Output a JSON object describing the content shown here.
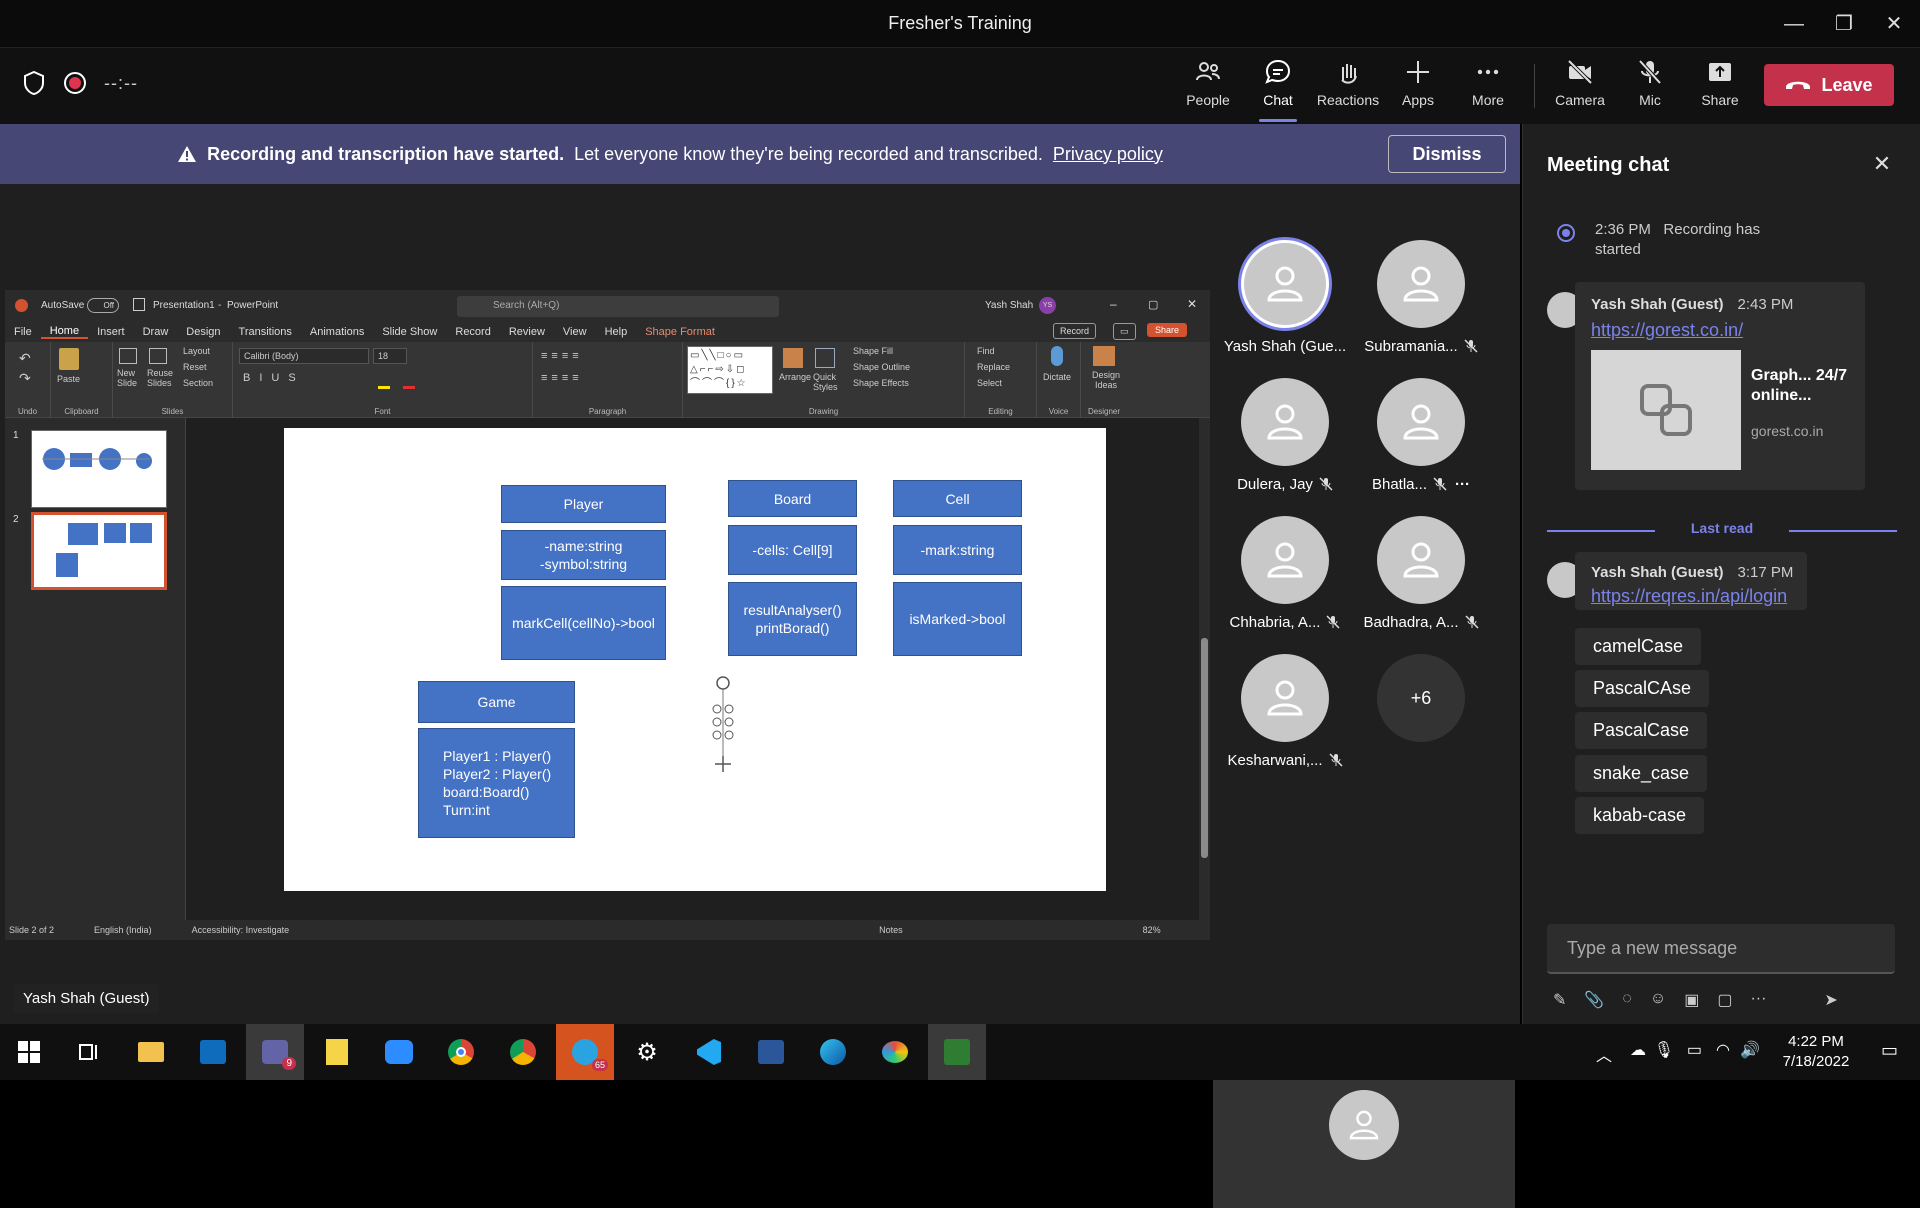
{
  "window": {
    "title": "Fresher's Training",
    "minimize": "—",
    "restore": "❐",
    "close": "✕"
  },
  "meeting_bar": {
    "timer": "--:--",
    "buttons": [
      {
        "label": "People"
      },
      {
        "label": "Chat"
      },
      {
        "label": "Reactions"
      },
      {
        "label": "Apps"
      },
      {
        "label": "More"
      },
      {
        "label": "Camera"
      },
      {
        "label": "Mic"
      },
      {
        "label": "Share"
      }
    ],
    "leave": "Leave",
    "accent": "#7b83eb",
    "leave_color": "#c4314b"
  },
  "banner": {
    "bold": "Recording and transcription have started.",
    "text": "Let everyone know they're being recorded and transcribed.",
    "link": "Privacy policy",
    "dismiss": "Dismiss"
  },
  "ppt": {
    "autosave": "AutoSave",
    "autosave_state": "Off",
    "file": "Presentation1",
    "app": "PowerPoint",
    "search": "Search (Alt+Q)",
    "user": "Yash Shah",
    "user_initials": "YS",
    "tabs": [
      "File",
      "Home",
      "Insert",
      "Draw",
      "Design",
      "Transitions",
      "Animations",
      "Slide Show",
      "Record",
      "Review",
      "View",
      "Help",
      "Shape Format"
    ],
    "record_btn": "Record",
    "share_btn": "Share",
    "groups": [
      "Undo",
      "Clipboard",
      "Slides",
      "Font",
      "Paragraph",
      "Drawing",
      "Editing",
      "Voice",
      "Designer"
    ],
    "ribbon": {
      "paste": "Paste",
      "new_slide": "New Slide",
      "reuse": "Reuse Slides",
      "layout": "Layout",
      "reset": "Reset",
      "section": "Section",
      "font": "Calibri (Body)",
      "size": "18",
      "arrange": "Arrange",
      "quick_styles": "Quick Styles",
      "shape_fill": "Shape Fill",
      "shape_outline": "Shape Outline",
      "shape_effects": "Shape Effects",
      "find": "Find",
      "replace": "Replace",
      "select": "Select",
      "dictate": "Dictate",
      "design_ideas": "Design Ideas"
    },
    "slide_numbers": [
      "1",
      "2"
    ],
    "slide": {
      "player": {
        "title": "Player",
        "attrs": "-name:string\n-symbol:string",
        "methods": "markCell(cellNo)->bool"
      },
      "board": {
        "title": "Board",
        "attrs": "-cells: Cell[9]",
        "methods": "resultAnalyser()\nprintBorad()"
      },
      "cell": {
        "title": "Cell",
        "attrs": "-mark:string",
        "methods": "isMarked->bool"
      },
      "game": {
        "title": "Game",
        "body": "Player1 : Player()\nPlayer2 : Player()\nboard:Board()\nTurn:int"
      }
    },
    "status": {
      "slide": "Slide 2 of 2",
      "lang": "English (India)",
      "access": "Accessibility: Investigate",
      "notes": "Notes",
      "zoom": "82%"
    }
  },
  "participants": [
    {
      "name": "Yash Shah (Gue..."
    },
    {
      "name": "Subramania..."
    },
    {
      "name": "Dulera, Jay"
    },
    {
      "name": "Bhatla..."
    },
    {
      "name": "Chhabria, A..."
    },
    {
      "name": "Badhadra, A..."
    },
    {
      "name": "Kesharwani,..."
    },
    {
      "name": "+6"
    }
  ],
  "speaker_label": "Yash Shah (Guest)",
  "chat": {
    "title": "Meeting chat",
    "system": {
      "time": "2:36 PM",
      "text": "Recording has started"
    },
    "messages": [
      {
        "author": "Yash Shah (Guest)",
        "time": "2:43 PM",
        "link": "https://gorest.co.in/",
        "preview_title": "Graph... 24/7 online...",
        "preview_domain": "gorest.co.in"
      },
      {
        "author": "Yash Shah (Guest)",
        "time": "3:17 PM",
        "link": "https://reqres.in/api/login"
      }
    ],
    "last_read": "Last read",
    "pills": [
      "camelCase",
      "PascalCAse",
      "PascalCase",
      "snake_case",
      "kabab-case"
    ],
    "compose_placeholder": "Type a new message"
  },
  "taskbar": {
    "teams_badge": "9",
    "telegram_badge": "65",
    "time": "4:22 PM",
    "date": "7/18/2022"
  }
}
